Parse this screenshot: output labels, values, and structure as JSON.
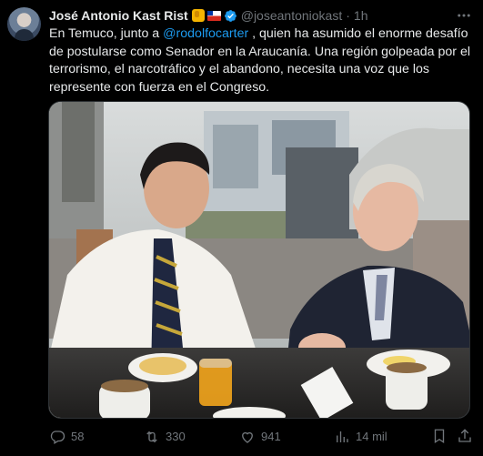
{
  "author": {
    "name": "José Antonio Kast Rist",
    "handle": "@joseantoniokast",
    "separator": "·",
    "time": "1h"
  },
  "icons": {
    "emoji_1": "thumbs-up-icon",
    "emoji_2": "chile-flag-icon",
    "verified": "verified-badge-icon",
    "more": "more-options-icon"
  },
  "tweet": {
    "text_before": "En Temuco, junto a ",
    "mention": "@rodolfocarter",
    "text_after": " , quien ha asumido el enorme desafío de postularse como Senador en la Araucanía. Una región golpeada por el terrorismo, el narcotráfico y el abandono, necesita una voz que los represente con fuerza en el Congreso."
  },
  "actions": {
    "replies": "58",
    "reposts": "330",
    "likes": "941",
    "views": "14 mil"
  },
  "colors": {
    "background": "#000000",
    "text": "#e7e9ea",
    "muted": "#71767b",
    "accent": "#1d9bf0"
  }
}
